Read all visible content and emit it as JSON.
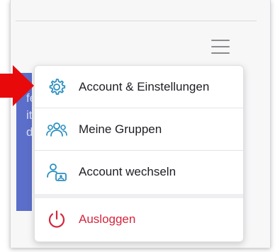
{
  "menu": {
    "items": [
      {
        "label": "Account & Einstellungen",
        "icon": "gear-icon"
      },
      {
        "label": "Meine Gruppen",
        "icon": "group-icon"
      },
      {
        "label": "Account wechseln",
        "icon": "switch-account-icon"
      }
    ],
    "logout": {
      "label": "Ausloggen",
      "icon": "power-icon"
    }
  },
  "background": {
    "panel_text": [
      "fe",
      "it",
      "d"
    ]
  },
  "colors": {
    "accent": "#2a8fbf",
    "logout": "#d4253d",
    "panel": "#5b6ec9",
    "arrow": "#e8090b"
  }
}
